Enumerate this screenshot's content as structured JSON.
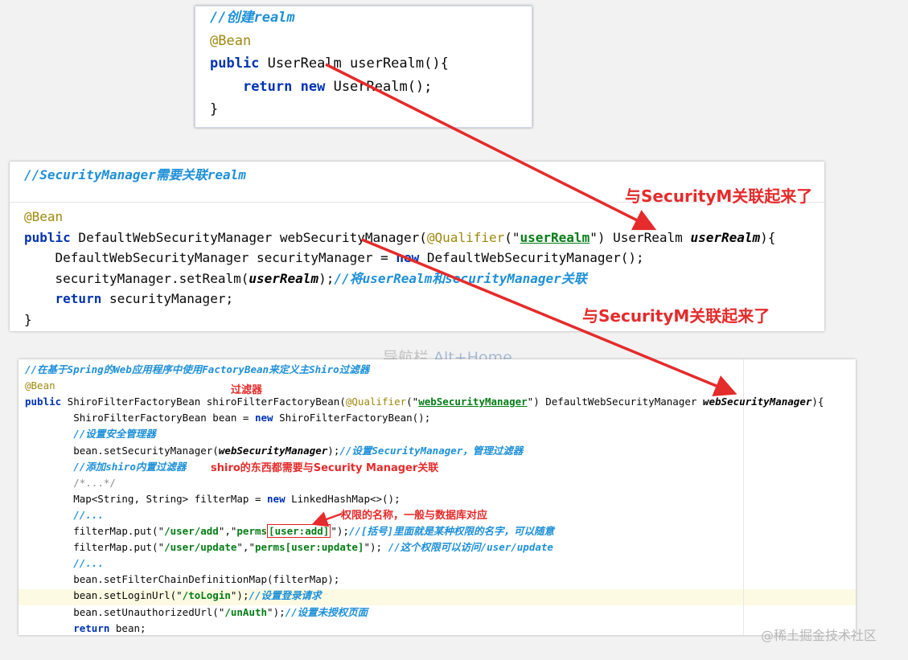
{
  "panel_top": {
    "lines": [
      [
        {
          "t": "//创建realm",
          "c": "cm"
        }
      ],
      [
        {
          "t": "@Bean",
          "c": "ann"
        }
      ],
      [
        {
          "t": "public",
          "c": "kw"
        },
        {
          "t": " UserRealm userRealm(){",
          "c": "plain"
        }
      ],
      [
        {
          "t": "    ",
          "c": "plain"
        },
        {
          "t": "return",
          "c": "kw"
        },
        {
          "t": " ",
          "c": "plain"
        },
        {
          "t": "new",
          "c": "kw"
        },
        {
          "t": " UserRealm();",
          "c": "plain"
        }
      ],
      [
        {
          "t": "}",
          "c": "plain"
        }
      ]
    ]
  },
  "panel_mid": {
    "header": [
      {
        "t": "//SecurityManager需要关联realm",
        "c": "cm"
      }
    ],
    "lines": [
      [
        {
          "t": "@Bean",
          "c": "ann"
        }
      ],
      [
        {
          "t": "public",
          "c": "kw"
        },
        {
          "t": " DefaultWebSecurityManager webSecurityManager(",
          "c": "plain"
        },
        {
          "t": "@Qualifier",
          "c": "ann"
        },
        {
          "t": "(\"",
          "c": "plain"
        },
        {
          "t": "userRealm",
          "c": "strul"
        },
        {
          "t": "\") UserRealm ",
          "c": "plain"
        },
        {
          "t": "userRealm",
          "c": "it"
        },
        {
          "t": "){",
          "c": "plain"
        }
      ],
      [
        {
          "t": "    DefaultWebSecurityManager securityManager = ",
          "c": "plain"
        },
        {
          "t": "new",
          "c": "kw"
        },
        {
          "t": " DefaultWebSecurityManager();",
          "c": "plain"
        }
      ],
      [
        {
          "t": "    securityManager.setRealm(",
          "c": "plain"
        },
        {
          "t": "userRealm",
          "c": "it"
        },
        {
          "t": ");",
          "c": "plain"
        },
        {
          "t": "//将userRealm和securityManager关联",
          "c": "cm"
        }
      ],
      [
        {
          "t": "    ",
          "c": "plain"
        },
        {
          "t": "return",
          "c": "kw"
        },
        {
          "t": " securityManager;",
          "c": "plain"
        }
      ],
      [
        {
          "t": "}",
          "c": "plain"
        }
      ]
    ]
  },
  "panel_bottom": {
    "lines": [
      [
        {
          "t": "//在基于Spring的Web应用程序中使用FactoryBean来定义主Shiro过滤器",
          "c": "cm"
        }
      ],
      [
        {
          "t": "@Bean",
          "c": "ann"
        }
      ],
      [
        {
          "t": "public",
          "c": "kw"
        },
        {
          "t": " ShiroFilterFactoryBean shiroFilterFactoryBean(",
          "c": "plain"
        },
        {
          "t": "@Qualifier",
          "c": "ann"
        },
        {
          "t": "(\"",
          "c": "plain"
        },
        {
          "t": "webSecurityManager",
          "c": "strul"
        },
        {
          "t": "\") DefaultWebSecurityManager ",
          "c": "plain"
        },
        {
          "t": "webSecurityManager",
          "c": "it"
        },
        {
          "t": "){",
          "c": "plain"
        }
      ],
      [
        {
          "t": "        ShiroFilterFactoryBean bean = ",
          "c": "plain"
        },
        {
          "t": "new",
          "c": "kw"
        },
        {
          "t": " ShiroFilterFactoryBean();",
          "c": "plain"
        }
      ],
      [
        {
          "t": "        ",
          "c": "plain"
        },
        {
          "t": "//设置安全管理器",
          "c": "cm"
        }
      ],
      [
        {
          "t": "        bean.setSecurityManager(",
          "c": "plain"
        },
        {
          "t": "webSecurityManager",
          "c": "it"
        },
        {
          "t": ");",
          "c": "plain"
        },
        {
          "t": "//设置SecurityManager，管理过滤器",
          "c": "cm"
        }
      ],
      [
        {
          "t": "        ",
          "c": "plain"
        },
        {
          "t": "//添加shiro内置过滤器",
          "c": "cm"
        }
      ],
      [
        {
          "t": "        ",
          "c": "plain"
        },
        {
          "t": "/*...*/",
          "c": "cmg"
        }
      ],
      [
        {
          "t": "        Map<String, String> filterMap = ",
          "c": "plain"
        },
        {
          "t": "new",
          "c": "kw"
        },
        {
          "t": " LinkedHashMap<>();",
          "c": "plain"
        }
      ],
      [
        {
          "t": "        ",
          "c": "plain"
        },
        {
          "t": "//...",
          "c": "cm"
        }
      ],
      [
        {
          "t": "        filterMap.put(\"",
          "c": "plain"
        },
        {
          "t": "/user/add",
          "c": "str"
        },
        {
          "t": "\",\"",
          "c": "plain"
        },
        {
          "t": "perms",
          "c": "str"
        },
        {
          "t": "[user:add]",
          "c": "str",
          "box": true
        },
        {
          "t": "\");",
          "c": "plain"
        },
        {
          "t": "//[括号]里面就是某种权限的名字，可以随意",
          "c": "cm"
        }
      ],
      [
        {
          "t": "        filterMap.put(\"",
          "c": "plain"
        },
        {
          "t": "/user/update",
          "c": "str"
        },
        {
          "t": "\",\"",
          "c": "plain"
        },
        {
          "t": "perms[user:update]",
          "c": "str"
        },
        {
          "t": "\"); ",
          "c": "plain"
        },
        {
          "t": "//这个权限可以访问/user/update",
          "c": "cm"
        }
      ],
      [
        {
          "t": "        ",
          "c": "plain"
        },
        {
          "t": "//...",
          "c": "cm"
        }
      ],
      [
        {
          "t": "        bean.setFilterChainDefinitionMap(filterMap);",
          "c": "plain"
        }
      ],
      [
        {
          "t": "        bean.setLoginUrl(\"",
          "c": "plain"
        },
        {
          "t": "/toLogin",
          "c": "str"
        },
        {
          "t": "\");",
          "c": "plain"
        },
        {
          "t": "//设置登录请求",
          "c": "cm"
        }
      ],
      [
        {
          "t": "        bean.setUnauthorizedUrl(\"",
          "c": "plain"
        },
        {
          "t": "/unAuth",
          "c": "str"
        },
        {
          "t": "\");",
          "c": "plain"
        },
        {
          "t": "//设置未授权页面",
          "c": "cm"
        }
      ],
      [
        {
          "t": "        ",
          "c": "plain"
        },
        {
          "t": "return",
          "c": "kw"
        },
        {
          "t": " bean;",
          "c": "plain"
        }
      ]
    ]
  },
  "annotations": {
    "link1": "与SecurityM关联起来了",
    "link2": "与SecurityM关联起来了",
    "filter": "过滤器",
    "shiro_note": "shiro的东西都需要与Security Manager关联",
    "perm_note": "权限的名称，一般与数据库对应"
  },
  "ghost_hint": {
    "label": "导航栏 ",
    "shortcut": "Alt+Home"
  },
  "watermark": "@稀土掘金技术社区",
  "colors": {
    "arrow": "#e52b2b",
    "keyword": "#0033b3",
    "comment": "#1e90d8",
    "string": "#067d17",
    "annotation": "#9e880d"
  }
}
